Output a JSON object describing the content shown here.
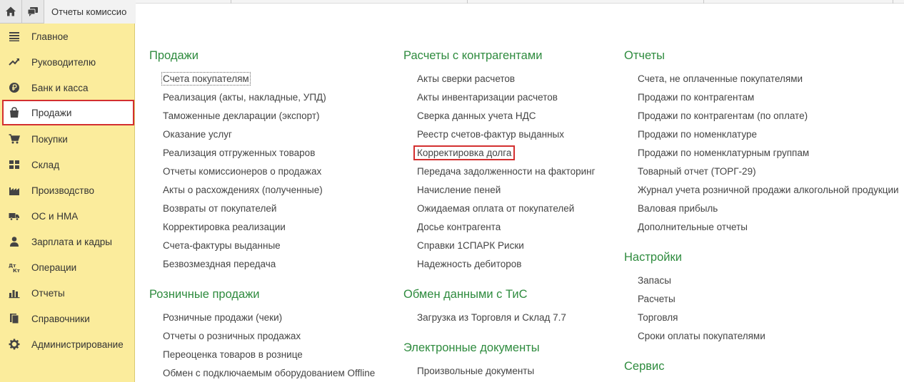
{
  "topbar": {
    "tab_label": "Отчеты комиссио"
  },
  "sidebar": {
    "items": [
      {
        "label": "Главное",
        "icon": "menu-lines-icon"
      },
      {
        "label": "Руководителю",
        "icon": "trend-icon"
      },
      {
        "label": "Банк и касса",
        "icon": "ruble-coin-icon"
      },
      {
        "label": "Продажи",
        "icon": "shopping-bag-icon",
        "active": true
      },
      {
        "label": "Покупки",
        "icon": "cart-icon"
      },
      {
        "label": "Склад",
        "icon": "warehouse-grid-icon"
      },
      {
        "label": "Производство",
        "icon": "factory-icon"
      },
      {
        "label": "ОС и НМА",
        "icon": "truck-icon"
      },
      {
        "label": "Зарплата и кадры",
        "icon": "person-icon"
      },
      {
        "label": "Операции",
        "icon": "dt-kt-icon"
      },
      {
        "label": "Отчеты",
        "icon": "bar-chart-icon"
      },
      {
        "label": "Справочники",
        "icon": "books-icon"
      },
      {
        "label": "Администрирование",
        "icon": "gear-icon"
      }
    ]
  },
  "columns": {
    "col1": {
      "sections": [
        {
          "title": "Продажи",
          "links": [
            "Счета покупателям",
            "Реализация (акты, накладные, УПД)",
            "Таможенные декларации (экспорт)",
            "Оказание услуг",
            "Реализация отгруженных товаров",
            "Отчеты комиссионеров о продажах",
            "Акты о расхождениях (полученные)",
            "Возвраты от покупателей",
            "Корректировка реализации",
            "Счета-фактуры выданные",
            "Безвозмездная передача"
          ]
        },
        {
          "title": "Розничные продажи",
          "links": [
            "Розничные продажи (чеки)",
            "Отчеты о розничных продажах",
            "Переоценка товаров в рознице",
            "Обмен с подключаемым оборудованием Offline"
          ]
        }
      ]
    },
    "col2": {
      "sections": [
        {
          "title": "Расчеты с контрагентами",
          "links": [
            "Акты сверки расчетов",
            "Акты инвентаризации расчетов",
            "Сверка данных учета НДС",
            "Реестр счетов-фактур выданных",
            "Корректировка долга",
            "Передача задолженности на факторинг",
            "Начисление пеней",
            "Ожидаемая оплата от покупателей",
            "Досье контрагента",
            "Справки 1СПАРК Риски",
            "Надежность дебиторов"
          ]
        },
        {
          "title": "Обмен данными с ТиС",
          "links": [
            "Загрузка из Торговля и Склад 7.7"
          ]
        },
        {
          "title": "Электронные документы",
          "links": [
            "Произвольные документы"
          ]
        }
      ]
    },
    "col3": {
      "sections": [
        {
          "title": "Отчеты",
          "links": [
            "Счета, не оплаченные покупателями",
            "Продажи по контрагентам",
            "Продажи по контрагентам (по оплате)",
            "Продажи по номенклатуре",
            "Продажи по номенклатурным группам",
            "Товарный отчет (ТОРГ-29)",
            "Журнал учета розничной продажи алкогольной продукции",
            "Валовая прибыль",
            "Дополнительные отчеты"
          ]
        },
        {
          "title": "Настройки",
          "links": [
            "Запасы",
            "Расчеты",
            "Торговля",
            "Сроки оплаты покупателями"
          ]
        },
        {
          "title": "Сервис",
          "links": []
        }
      ]
    }
  },
  "colors": {
    "sidebar_bg": "#fbec9c",
    "section_title": "#2e8b3e",
    "highlight": "#d32f2f"
  }
}
